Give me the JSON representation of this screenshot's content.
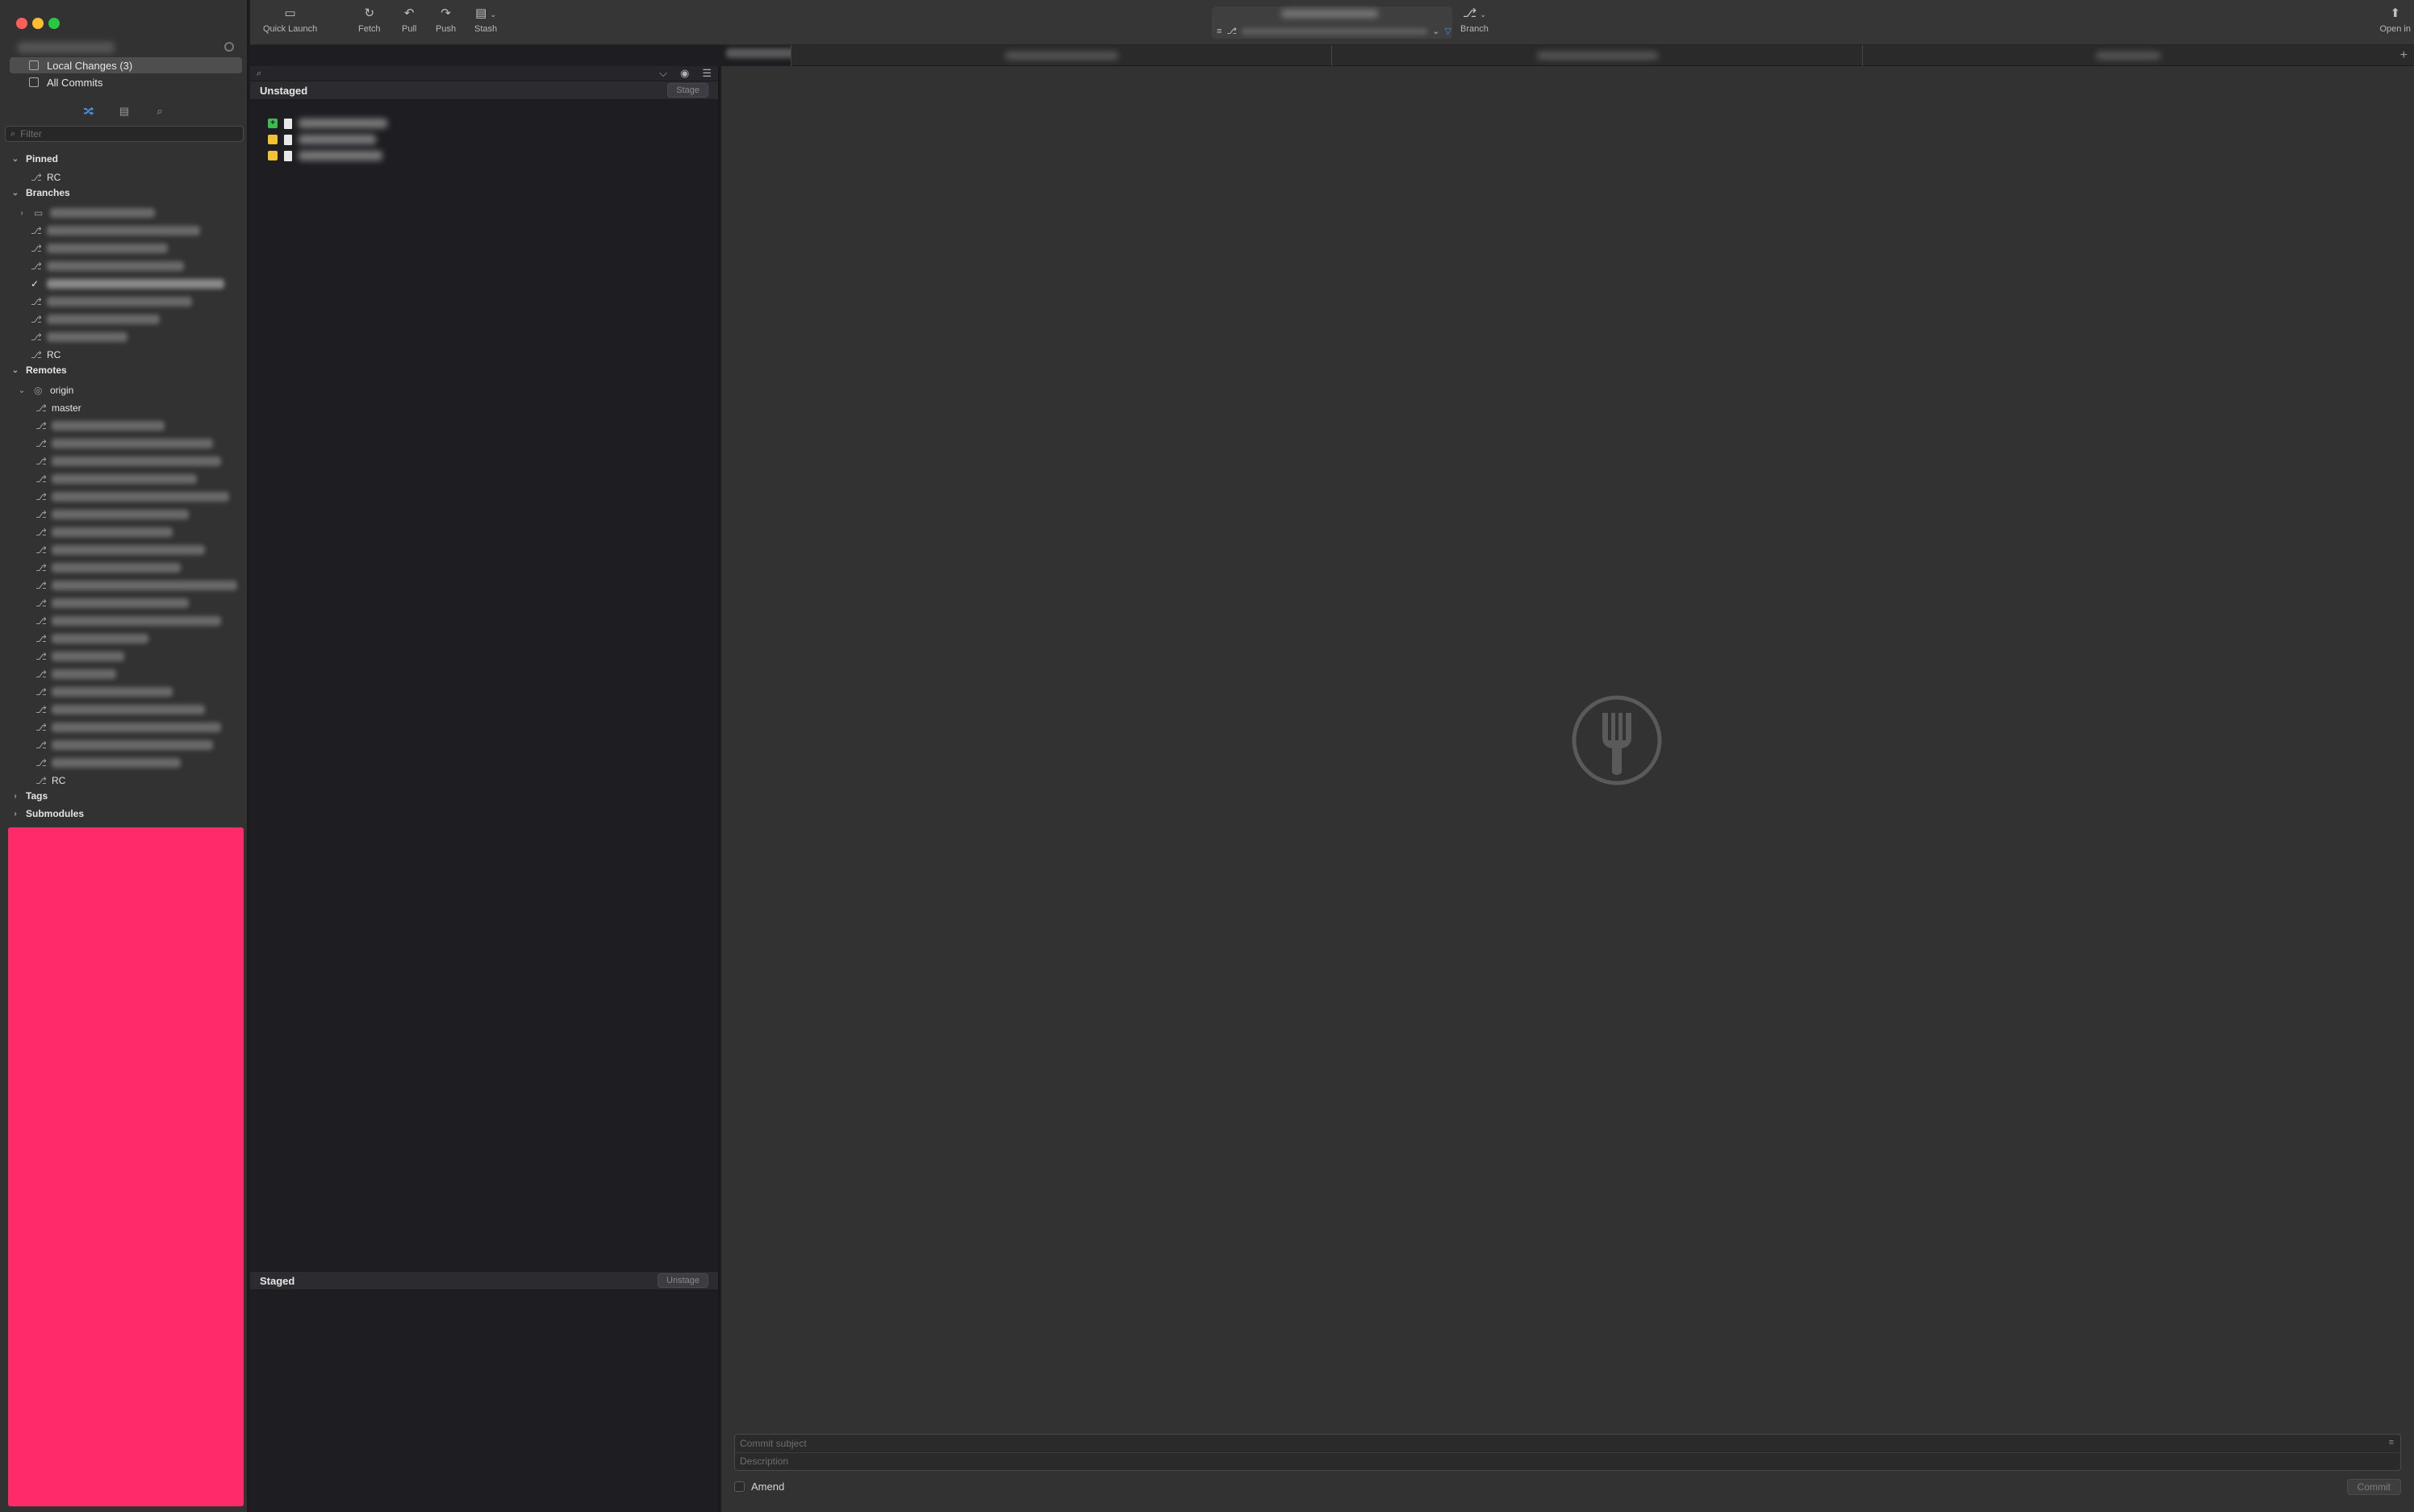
{
  "window": {
    "traffic_lights": {
      "close": "#ff5f57",
      "minimize": "#febc2e",
      "zoom": "#28c840"
    },
    "accent_color": "#4a90e2",
    "highlight_color": "#ff2a68"
  },
  "sidebar": {
    "nav": [
      {
        "label": "Local Changes (3)",
        "icon": "local-changes-icon",
        "selected": true
      },
      {
        "label": "All Commits",
        "icon": "all-commits-icon",
        "selected": false
      }
    ],
    "tab_icons": [
      "branch-icon",
      "archive-icon",
      "search-icon"
    ],
    "filter_placeholder": "Filter",
    "sections": {
      "pinned": {
        "label": "Pinned",
        "items": [
          "RC"
        ]
      },
      "branches": {
        "label": "Branches",
        "last_item": "RC"
      },
      "remotes": {
        "label": "Remotes",
        "remote": "origin",
        "first_item": "master",
        "last_item": "RC"
      },
      "tags": {
        "label": "Tags"
      },
      "submodules": {
        "label": "Submodules"
      }
    }
  },
  "toolbar": {
    "quick_launch": "Quick Launch",
    "fetch": "Fetch",
    "pull": "Pull",
    "push": "Push",
    "stash": "Stash",
    "branch": "Branch",
    "open_in": "Open in"
  },
  "files": {
    "filter_placeholder": "",
    "unstaged": {
      "title": "Unstaged",
      "button": "Stage",
      "items": [
        {
          "status": "added",
          "status_color": "#3dbb4c",
          "status_glyph": "+"
        },
        {
          "status": "modified",
          "status_color": "#f1c232",
          "status_glyph": ""
        },
        {
          "status": "modified",
          "status_color": "#f1c232",
          "status_glyph": ""
        }
      ]
    },
    "staged": {
      "title": "Staged",
      "button": "Unstage"
    }
  },
  "commit": {
    "subject_placeholder": "Commit subject",
    "description_placeholder": "Description",
    "amend_label": "Amend",
    "button": "Commit"
  }
}
